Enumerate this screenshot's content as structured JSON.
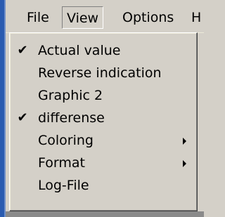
{
  "menubar": {
    "items": [
      {
        "label": "File"
      },
      {
        "label": "View"
      },
      {
        "label": "Options"
      },
      {
        "label": "H"
      }
    ]
  },
  "dropdown": {
    "items": [
      {
        "label": "Actual value",
        "check": "✔"
      },
      {
        "label": "Reverse indication",
        "check": ""
      },
      {
        "label": "Graphic 2",
        "check": ""
      },
      {
        "label": "differense",
        "check": "✔"
      },
      {
        "label": "Coloring",
        "check": ""
      },
      {
        "label": "Format",
        "check": ""
      },
      {
        "label": "Log-File",
        "check": ""
      }
    ]
  },
  "colors": {
    "menu_bg": "#d4d0c8",
    "window_left_edge": "#2a5bb0"
  }
}
